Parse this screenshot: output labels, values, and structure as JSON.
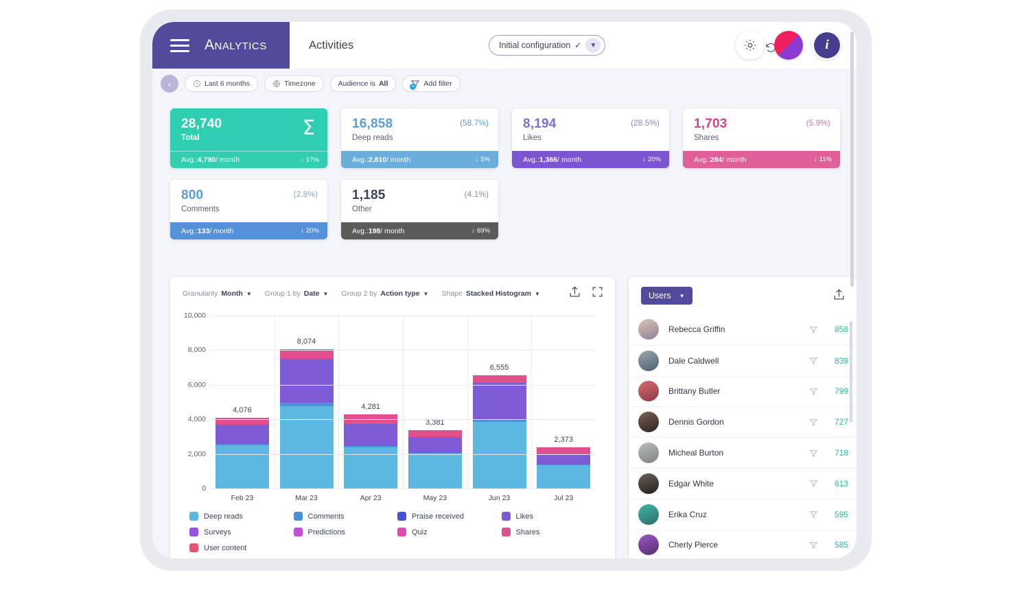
{
  "header": {
    "brand": "Analytics",
    "page_title": "Activities",
    "config_label": "Initial configuration",
    "check_glyph": "✓",
    "caret_glyph": "❯",
    "save_icon": "save-icon",
    "undo_icon": "undo-icon",
    "gear_icon": "gear-icon",
    "avatar_icon": "user-avatar",
    "info_label": "i"
  },
  "filterbar": {
    "back_glyph": "‹",
    "chips": [
      {
        "icon": "clock-icon",
        "text": "Last 6 months",
        "bold": ""
      },
      {
        "icon": "globe-icon",
        "text": "Timezone",
        "bold": ""
      },
      {
        "icon": "",
        "text": "Audience  is ",
        "bold": "All"
      },
      {
        "icon": "add-filter-icon",
        "text": "Add filter",
        "bold": ""
      }
    ]
  },
  "kpis": [
    {
      "value": "28,740",
      "label": "Total",
      "pct": "",
      "avg_prefix": "Avg.: ",
      "avg_value": "4,790",
      "avg_suffix": " / month",
      "trend_arrow": "↓",
      "trend": "17%",
      "sigma": "Σ",
      "top_color": "#2ecfb0",
      "bottom_color": "#33cdb0",
      "value_color": "#ffffff"
    },
    {
      "value": "16,858",
      "label": "Deep reads",
      "pct": "(58.7%)",
      "avg_prefix": "Avg.: ",
      "avg_value": "2,810",
      "avg_suffix": " / month",
      "trend_arrow": "↓",
      "trend": "5%",
      "sigma": "",
      "top_color": "#ffffff",
      "bottom_color": "#6aaedb",
      "value_color": "#5a9fd4"
    },
    {
      "value": "8,194",
      "label": "Likes",
      "pct": "(28.5%)",
      "avg_prefix": "Avg.: ",
      "avg_value": "1,366",
      "avg_suffix": " / month",
      "trend_arrow": "↓",
      "trend": "20%",
      "sigma": "",
      "top_color": "#ffffff",
      "bottom_color": "#7b55cf",
      "value_color": "#7b6fd0"
    },
    {
      "value": "1,703",
      "label": "Shares",
      "pct": "(5.9%)",
      "avg_prefix": "Avg.: ",
      "avg_value": "284",
      "avg_suffix": " / month",
      "trend_arrow": "↓",
      "trend": "11%",
      "sigma": "",
      "top_color": "#ffffff",
      "bottom_color": "#df5f99",
      "value_color": "#d4448a"
    },
    {
      "value": "800",
      "label": "Comments",
      "pct": "(2.8%)",
      "avg_prefix": "Avg.: ",
      "avg_value": "133",
      "avg_suffix": " / month",
      "trend_arrow": "↓",
      "trend": "20%",
      "sigma": "",
      "top_color": "#ffffff",
      "bottom_color": "#5591d8",
      "value_color": "#5a9fd4"
    },
    {
      "value": "1,185",
      "label": "Other",
      "pct": "(4.1%)",
      "avg_prefix": "Avg.: ",
      "avg_value": "198",
      "avg_suffix": " / month",
      "trend_arrow": "↓",
      "trend": "69%",
      "sigma": "",
      "top_color": "#ffffff",
      "bottom_color": "#5b5b5b",
      "value_color": "#3c4257"
    }
  ],
  "chart_toolbar": {
    "granularity_label": "Granularity",
    "granularity_value": "Month",
    "group1_label": "Group 1 by",
    "group1_value": "Date",
    "group2_label": "Group 2 by",
    "group2_value": "Action type",
    "shape_label": "Shape",
    "shape_value": "Stacked Histogram",
    "export_icon": "export-icon",
    "fullscreen_icon": "fullscreen-icon"
  },
  "chart_data": {
    "type": "bar",
    "title": "",
    "xlabel": "",
    "ylabel": "",
    "stacked": true,
    "grid": true,
    "legend_position": "bottom",
    "ylim": [
      0,
      10000
    ],
    "yticks": [
      "0",
      "2,000",
      "4,000",
      "6,000",
      "8,000",
      "10,000"
    ],
    "ytick_values": [
      0,
      2000,
      4000,
      6000,
      8000,
      10000
    ],
    "categories": [
      "Feb 23",
      "Mar 23",
      "Apr 23",
      "May 23",
      "Jun 23",
      "Jul 23"
    ],
    "totals": [
      "4,076",
      "8,074",
      "4,281",
      "3,381",
      "6,555",
      "2,373"
    ],
    "total_values": [
      4076,
      8074,
      4281,
      3381,
      6555,
      2373
    ],
    "series": [
      {
        "name": "Deep reads",
        "color": "#5cb8e0",
        "values": [
          2520,
          4780,
          2400,
          2030,
          3840,
          1340
        ]
      },
      {
        "name": "Comments",
        "color": "#4a90d9",
        "values": [
          60,
          200,
          60,
          40,
          130,
          50
        ]
      },
      {
        "name": "Praise received",
        "color": "#4a52d4",
        "values": [
          0,
          0,
          0,
          0,
          0,
          0
        ]
      },
      {
        "name": "Likes",
        "color": "#7d5bd6",
        "values": [
          1110,
          2530,
          1290,
          900,
          2140,
          600
        ]
      },
      {
        "name": "Surveys",
        "color": "#9355e0",
        "values": [
          0,
          0,
          0,
          0,
          0,
          0
        ]
      },
      {
        "name": "Predictions",
        "color": "#c450d8",
        "values": [
          0,
          0,
          0,
          0,
          0,
          0
        ]
      },
      {
        "name": "Quiz",
        "color": "#e04ab6",
        "values": [
          0,
          0,
          0,
          0,
          0,
          0
        ]
      },
      {
        "name": "Shares",
        "color": "#e0508f",
        "values": [
          386,
          564,
          531,
          411,
          445,
          383
        ]
      },
      {
        "name": "User content",
        "color": "#e0576f",
        "values": [
          0,
          0,
          0,
          0,
          0,
          0
        ]
      }
    ]
  },
  "users_panel": {
    "select_label": "Users",
    "caret_glyph": "❯",
    "export_icon": "export-icon",
    "rows": [
      {
        "name": "Rebecca Griffin",
        "value": "858",
        "avatar_a": "#d9c7b4",
        "avatar_b": "#8f7f95"
      },
      {
        "name": "Dale Caldwell",
        "value": "839",
        "avatar_a": "#9aa6ad",
        "avatar_b": "#4f6170"
      },
      {
        "name": "Brittany Butler",
        "value": "799",
        "avatar_a": "#d96a72",
        "avatar_b": "#8c3b44"
      },
      {
        "name": "Dennis Gordon",
        "value": "727",
        "avatar_a": "#7a6154",
        "avatar_b": "#2e2422"
      },
      {
        "name": "Micheal Burton",
        "value": "718",
        "avatar_a": "#b9bcbd",
        "avatar_b": "#7f8486"
      },
      {
        "name": "Edgar White",
        "value": "613",
        "avatar_a": "#6b6258",
        "avatar_b": "#231f1d"
      },
      {
        "name": "Erika Cruz",
        "value": "595",
        "avatar_a": "#3fb8a8",
        "avatar_b": "#2b6b63"
      },
      {
        "name": "Cherly Pierce",
        "value": "585",
        "avatar_a": "#9a58c4",
        "avatar_b": "#56306e"
      }
    ]
  }
}
